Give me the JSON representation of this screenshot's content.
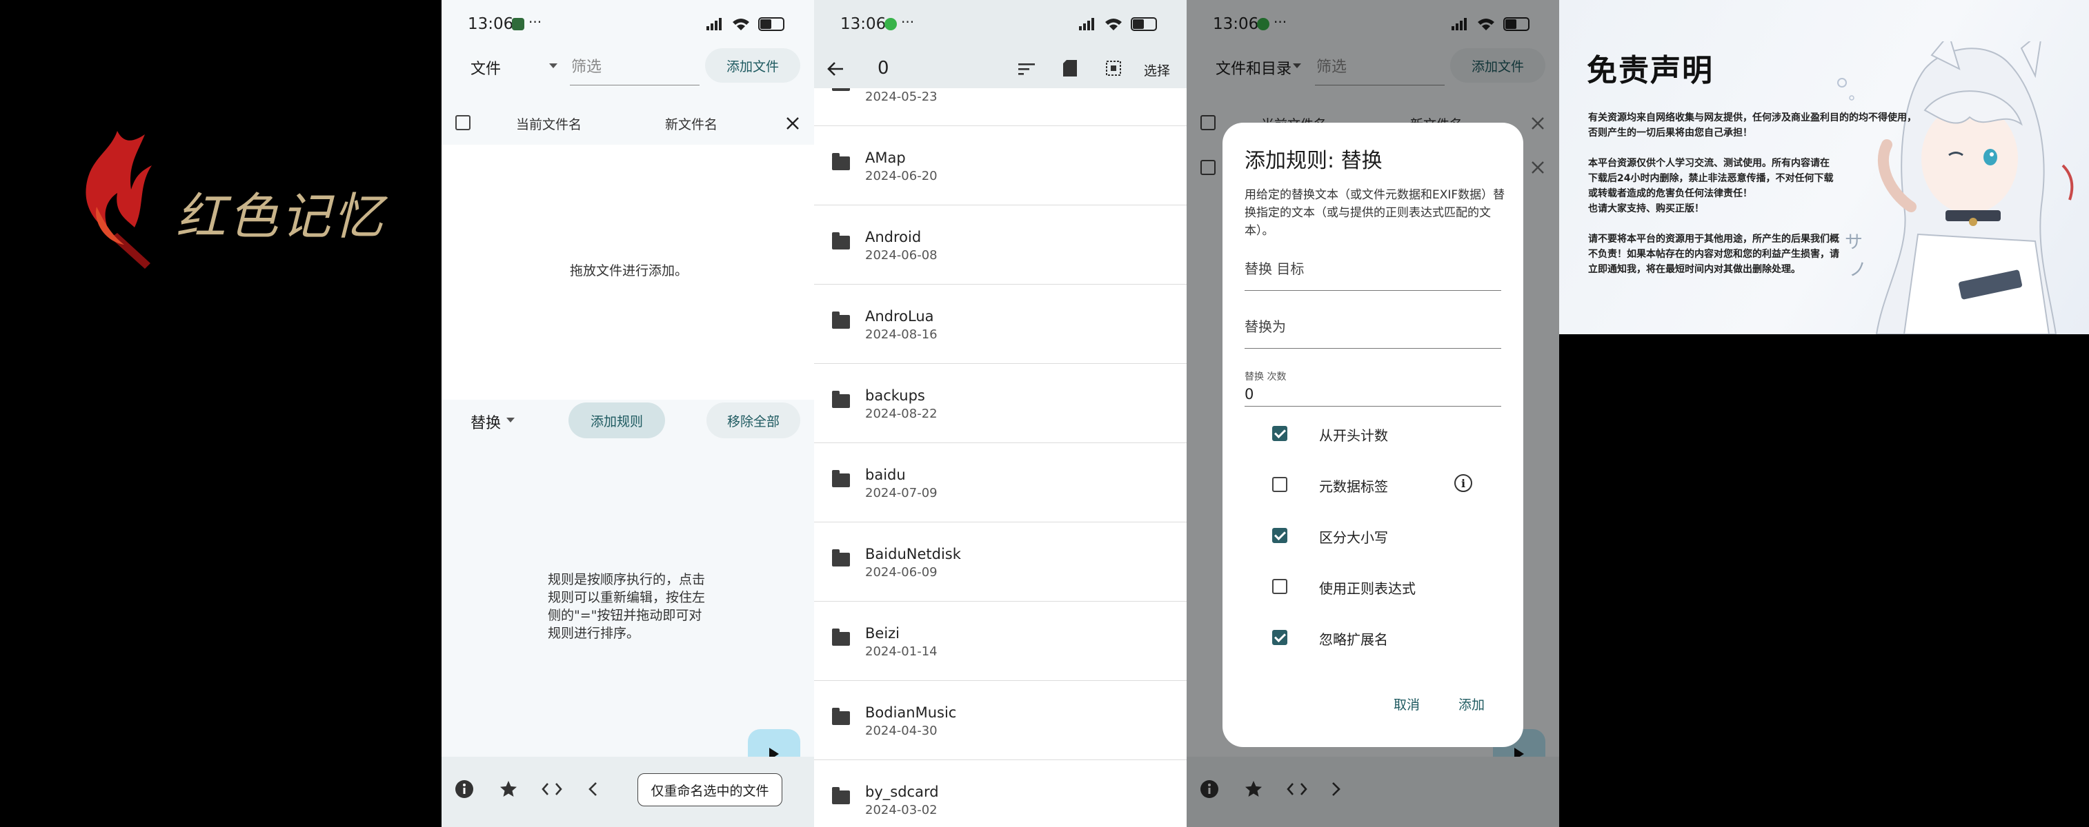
{
  "panel1": {
    "logo_text": "红色记忆"
  },
  "panel2": {
    "status": {
      "time": "13:06",
      "more": "···",
      "battery": "56"
    },
    "mode_label": "文件",
    "filter_placeholder": "筛选",
    "add_files_btn": "添加文件",
    "col_current": "当前文件名",
    "col_new": "新文件名",
    "drop_hint": "拖放文件进行添加。",
    "rule_type": "替换",
    "add_rule_btn": "添加规则",
    "remove_all_btn": "移除全部",
    "rules_hint": [
      "规则是按顺序执行的，点击",
      "规则可以重新编辑，按住左",
      "侧的\"=\"按钮并拖动即可对",
      "规则进行排序。"
    ],
    "bottom_btn": "仅重命名选中的文件"
  },
  "panel3": {
    "status": {
      "time": "13:06",
      "more": "···",
      "battery": "56"
    },
    "path_label": "0",
    "select_label": "选择",
    "files": [
      {
        "name": "",
        "date": "2024-05-23"
      },
      {
        "name": "AMap",
        "date": "2024-06-20"
      },
      {
        "name": "Android",
        "date": "2024-06-08"
      },
      {
        "name": "AndroLua",
        "date": "2024-08-16"
      },
      {
        "name": "backups",
        "date": "2024-08-22"
      },
      {
        "name": "baidu",
        "date": "2024-07-09"
      },
      {
        "name": "BaiduNetdisk",
        "date": "2024-06-09"
      },
      {
        "name": "Beizi",
        "date": "2024-01-14"
      },
      {
        "name": "BodianMusic",
        "date": "2024-04-30"
      },
      {
        "name": "by_sdcard",
        "date": "2024-03-02"
      }
    ]
  },
  "panel4": {
    "status": {
      "time": "13:06",
      "more": "···",
      "battery": "56"
    },
    "mode_label": "文件和目录",
    "filter_placeholder": "筛选",
    "add_files_btn": "添加文件",
    "bg_col_current": "当前文件名",
    "bg_col_new": "新文件名",
    "dialog": {
      "title": "添加规则: 替换",
      "description": "用给定的替换文本（或文件元数据和EXIF数据）替换指定的文本（或与提供的正则表达式匹配的文本）。",
      "target_label": "替换 目标",
      "replace_with_label": "替换为",
      "count_label": "替换 次数",
      "count_value": "0",
      "options": [
        {
          "label": "从开头计数",
          "checked": true
        },
        {
          "label": "元数据标签",
          "checked": false
        },
        {
          "label": "区分大小写",
          "checked": true
        },
        {
          "label": "使用正则表达式",
          "checked": false
        },
        {
          "label": "忽略扩展名",
          "checked": true
        }
      ],
      "cancel_btn": "取消",
      "add_btn": "添加"
    }
  },
  "panel5": {
    "title": "免责声明",
    "paragraphs": [
      [
        "有关资源均来自网络收集与网友提供，任何涉及商业盈利目的的均不得使用，",
        "否则产生的一切后果将由您自己承担！"
      ],
      [
        "本平台资源仅供个人学习交流、测试使用。所有内容请在",
        "下载后24小时内删除，禁止非法恶意传播，不对任何下载",
        "或转载者造成的危害负任何法律责任！",
        "也请大家支持、购买正版！"
      ],
      [
        "请不要将本平台的资源用于其他用途，所产生的后果我们概",
        "不负责！如果本帖存在的内容对您和您的利益产生损害，请",
        "立即通知我，将在最短时间内对其做出删除处理。"
      ]
    ]
  },
  "colors": {
    "accent": "#2a5e66",
    "fab": "#b6e3f3",
    "bg": "#f5f8fa"
  }
}
